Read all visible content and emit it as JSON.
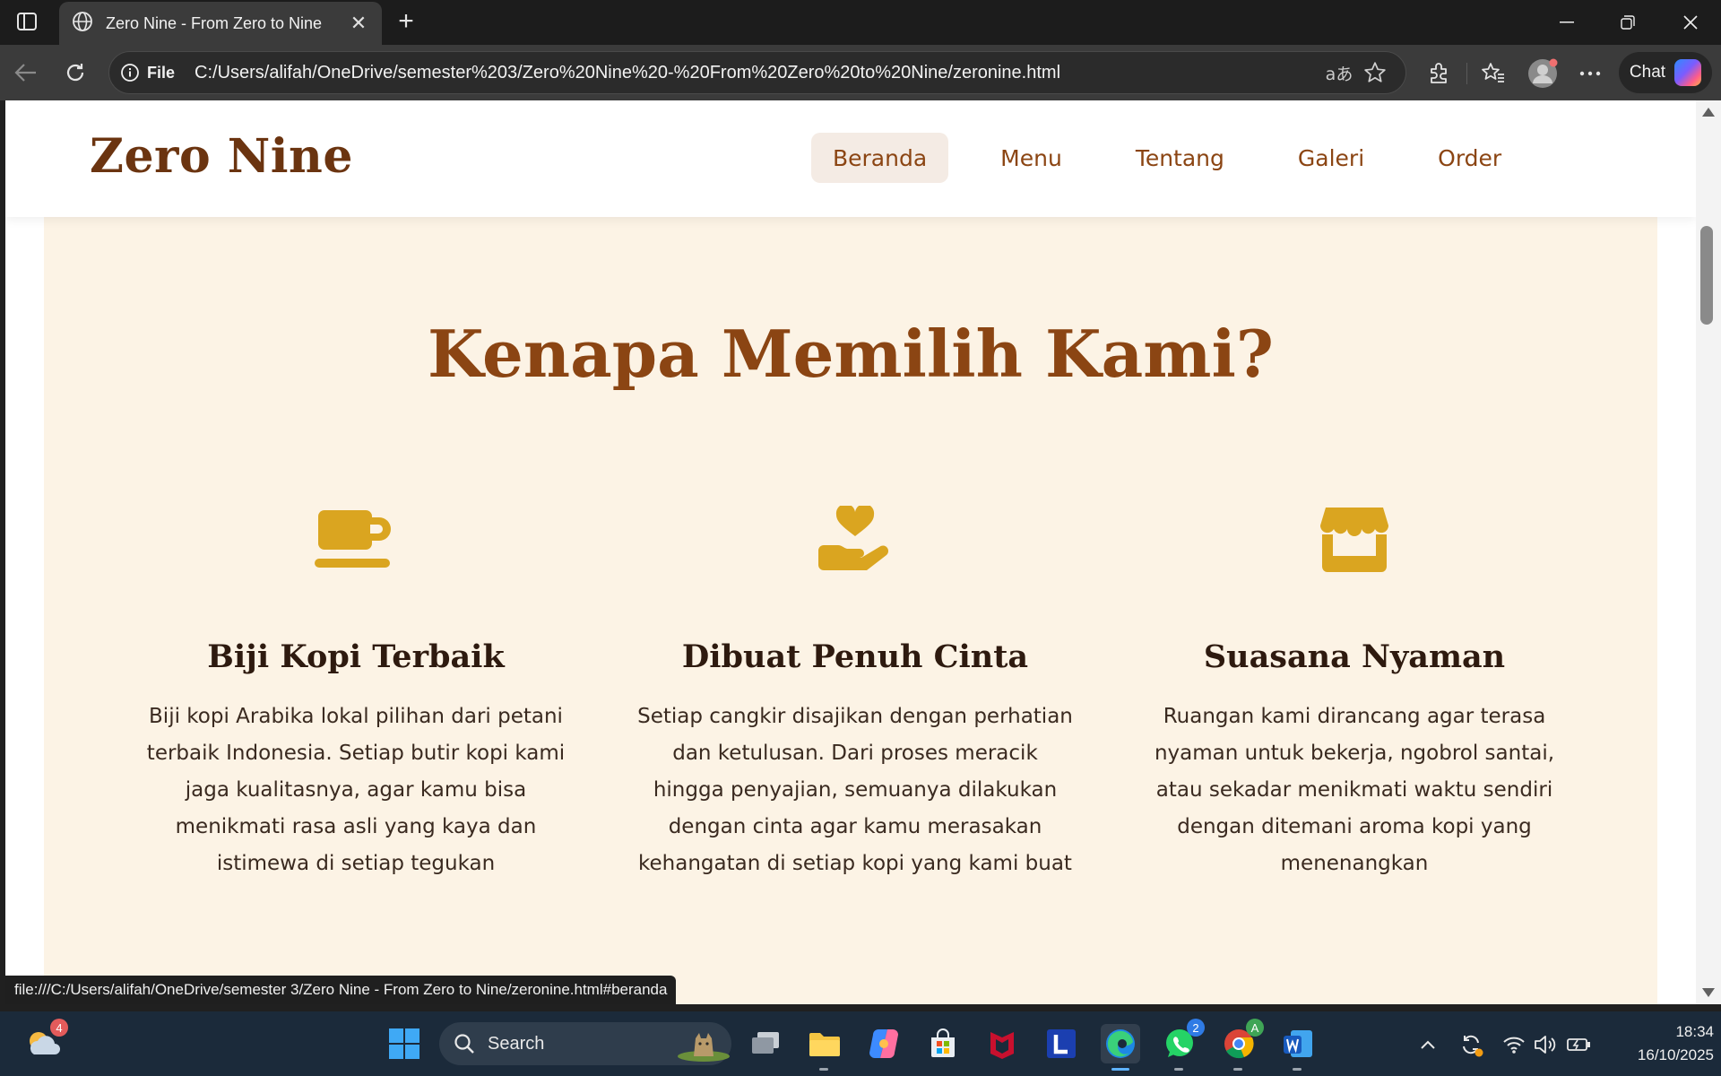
{
  "browser": {
    "tab_title": "Zero Nine - From Zero to Nine",
    "address_prefix": "File",
    "address_url": "C:/Users/alifah/OneDrive/semester%203/Zero%20Nine%20-%20From%20Zero%20to%20Nine/zeronine.html",
    "chat_label": "Chat",
    "status_url": "file:///C:/Users/alifah/OneDrive/semester 3/Zero Nine - From Zero to Nine/zeronine.html#beranda"
  },
  "site": {
    "brand": "Zero Nine",
    "nav": [
      {
        "label": "Beranda",
        "active": true
      },
      {
        "label": "Menu",
        "active": false
      },
      {
        "label": "Tentang",
        "active": false
      },
      {
        "label": "Galeri",
        "active": false
      },
      {
        "label": "Order",
        "active": false
      }
    ],
    "section_title": "Kenapa Memilih Kami?",
    "features": [
      {
        "icon": "coffee-cup-icon",
        "title": "Biji Kopi Terbaik",
        "description": "Biji kopi Arabika lokal pilihan dari petani terbaik Indonesia. Setiap butir kopi kami jaga kualitasnya, agar kamu bisa menikmati rasa asli yang kaya dan istimewa di setiap tegukan"
      },
      {
        "icon": "hand-heart-icon",
        "title": "Dibuat Penuh Cinta",
        "description": "Setiap cangkir disajikan dengan perhatian dan ketulusan. Dari proses meracik hingga penyajian, semuanya dilakukan dengan cinta agar kamu merasakan kehangatan di setiap kopi yang kami buat"
      },
      {
        "icon": "store-icon",
        "title": "Suasana Nyaman",
        "description": "Ruangan kami dirancang agar terasa nyaman untuk bekerja, ngobrol santai, atau sekadar menikmati waktu sendiri dengan ditemani aroma kopi yang menenangkan"
      }
    ],
    "colors": {
      "brand": "#6b3410",
      "accent": "#8b4513",
      "icon": "#daa520",
      "section_bg": "#fcf3e5"
    }
  },
  "taskbar": {
    "weather_badge": "4",
    "search_label": "Search",
    "whatsapp_badge": "2",
    "chrome_badge": "A",
    "time": "18:34",
    "date": "16/10/2025"
  }
}
